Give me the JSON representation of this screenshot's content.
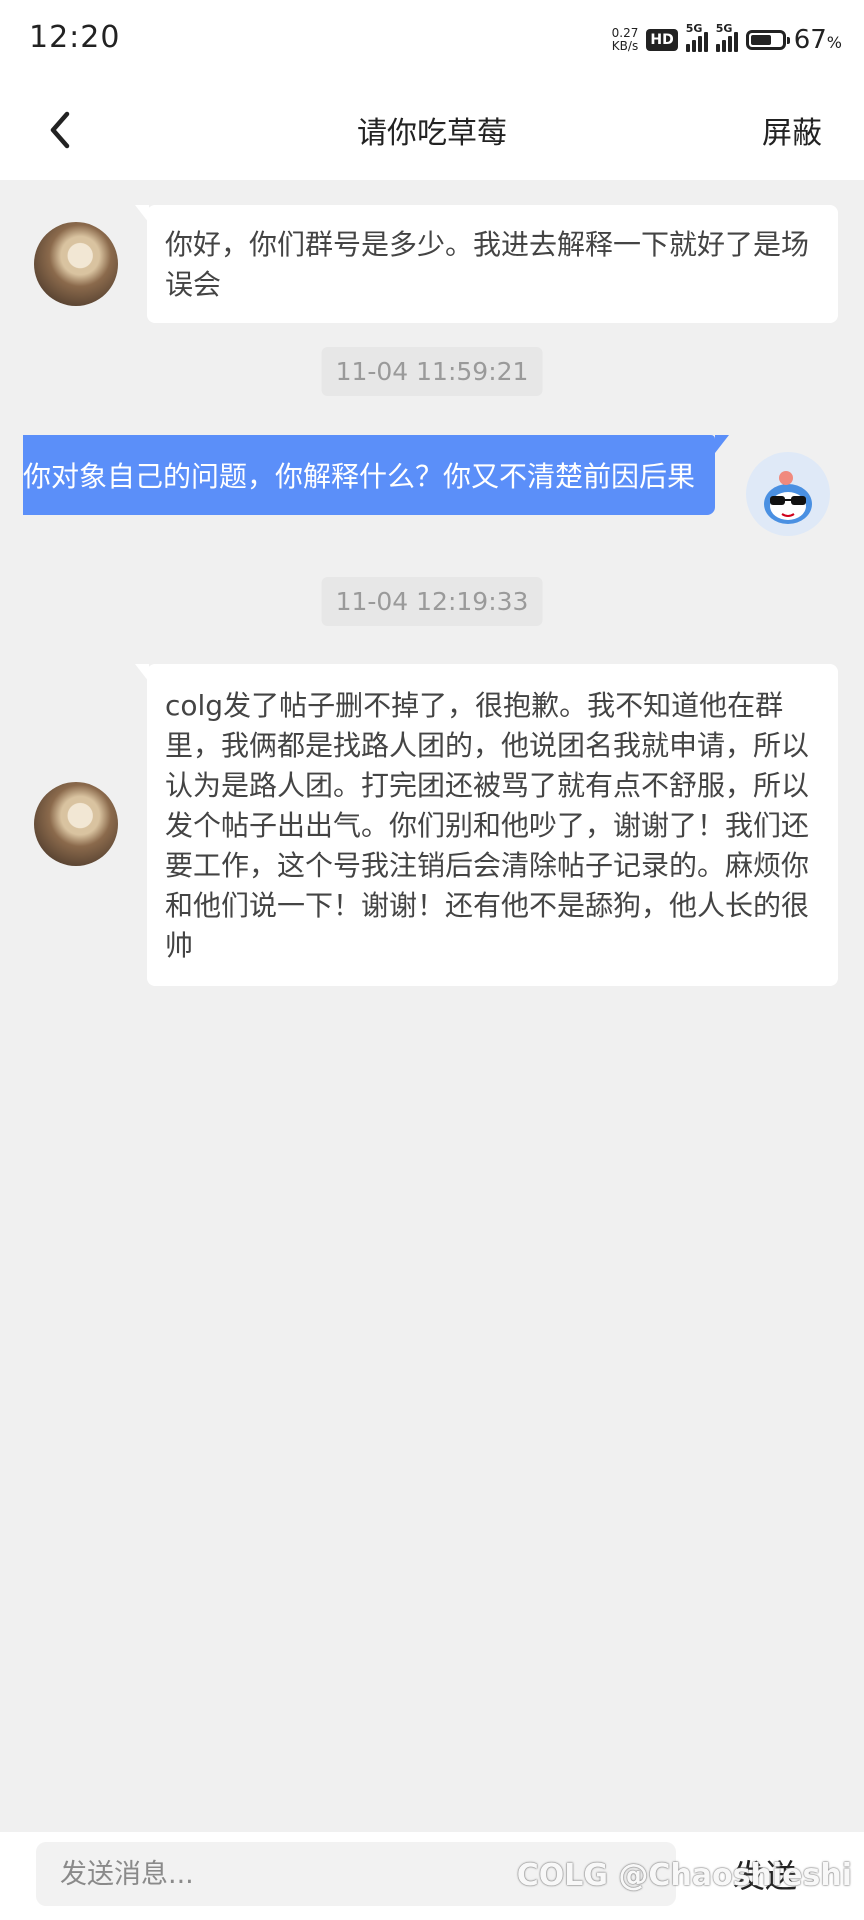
{
  "status_bar": {
    "time": "12:20",
    "net_speed_value": "0.27",
    "net_speed_unit": "KB/s",
    "hd_badge": "HD",
    "signal1_label": "5G",
    "signal2_label": "5G",
    "battery_level": 0.67,
    "battery_percent": "67",
    "battery_unit": "%"
  },
  "header": {
    "back_icon": "chevron-left-icon",
    "title": "请你吃草莓",
    "block_label": "屏蔽"
  },
  "messages": [
    {
      "side": "incoming",
      "text": "你好，你们群号是多少。我进去解释一下就好了是场误会"
    },
    {
      "type": "timestamp",
      "text": "11-04 11:59:21"
    },
    {
      "side": "outgoing",
      "text": "你对象自己的问题，你解释什么？你又不清楚前因后果"
    },
    {
      "type": "timestamp",
      "text": "11-04 12:19:33"
    },
    {
      "side": "incoming",
      "text": "colg发了帖子删不掉了，很抱歉。我不知道他在群里，我俩都是找路人团的，他说团名我就申请，所以认为是路人团。打完团还被骂了就有点不舒服，所以发个帖子出出气。你们别和他吵了，谢谢了！我们还要工作，这个号我注销后会清除帖子记录的。麻烦你和他们说一下！谢谢！还有他不是舔狗，他人长的很帅"
    }
  ],
  "input_bar": {
    "placeholder": "发送消息...",
    "send_label": "发送"
  },
  "watermark": "COLG @Chaoshieshi",
  "colors": {
    "outgoing_bubble": "#5b8ff9",
    "page_background": "#f0f0f0",
    "timestamp_background": "#e7e7e7"
  }
}
